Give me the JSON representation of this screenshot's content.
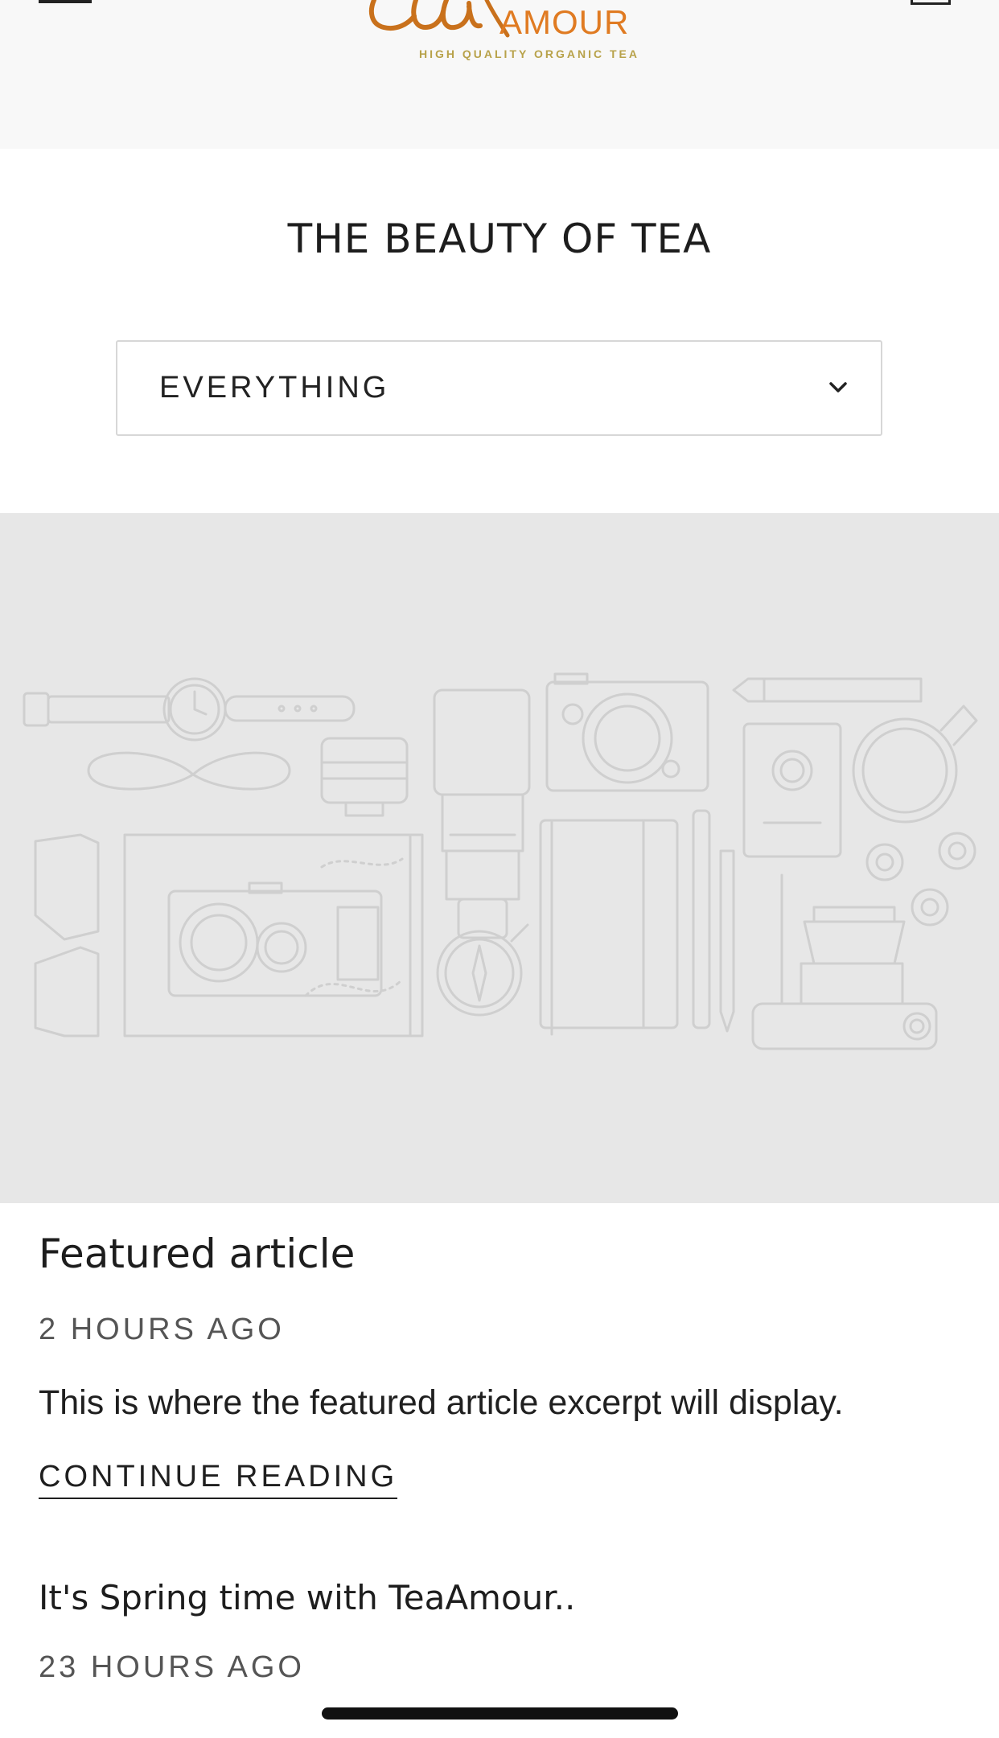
{
  "brand": {
    "logo_script": "tea",
    "logo_name": "AMOUR",
    "tagline": "HIGH QUALITY ORGANIC TEA",
    "color": "#c9711c",
    "tagline_color": "#b8a24a"
  },
  "page": {
    "title": "THE BEAUTY OF TEA"
  },
  "filter": {
    "selected": "EVERYTHING",
    "icon": "chevron-down-icon"
  },
  "featured": {
    "title": "Featured article",
    "date": "2 HOURS AGO",
    "excerpt": "This is where the featured article excerpt will display.",
    "link_label": "CONTINUE READING",
    "image_icon": "placeholder-illustration"
  },
  "articles": [
    {
      "title": "It's Spring time with TeaAmour..",
      "date": "23 HOURS AGO"
    }
  ],
  "colors": {
    "header_bg": "#f8f8f8",
    "hero_bg": "#e7e7e7",
    "illustration_stroke": "#cfcfcf"
  }
}
